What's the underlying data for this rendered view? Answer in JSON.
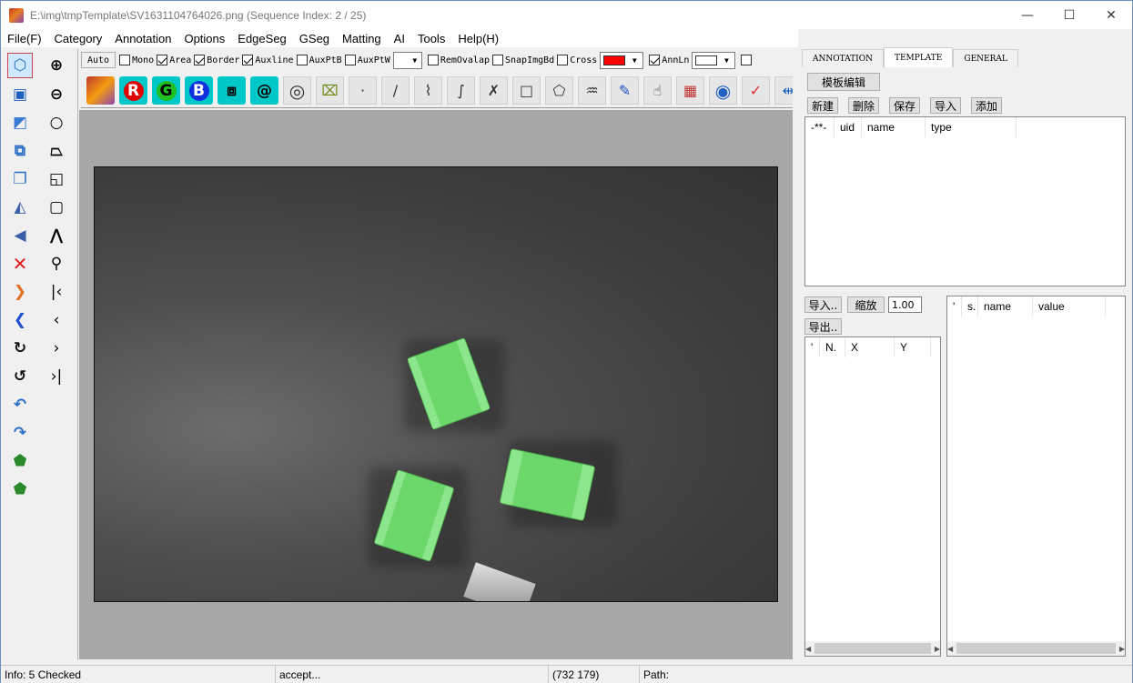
{
  "window": {
    "title": "E:\\img\\tmpTemplate\\SV1631104764026.png (Sequence Index: 2 / 25)",
    "minimize": "—",
    "maximize": "☐",
    "close": "✕"
  },
  "menu": [
    "File(F)",
    "Category",
    "Annotation",
    "Options",
    "EdgeSeg",
    "GSeg",
    "Matting",
    "AI",
    "Tools",
    "Help(H)"
  ],
  "options": {
    "auto_label": "Auto",
    "mono": {
      "label": "Mono",
      "checked": false
    },
    "area": {
      "label": "Area",
      "checked": true
    },
    "border": {
      "label": "Border",
      "checked": true
    },
    "auxline": {
      "label": "Auxline",
      "checked": true
    },
    "auxptb": {
      "label": "AuxPtB",
      "checked": false
    },
    "auxptw": {
      "label": "AuxPtW",
      "checked": false
    },
    "removalap": {
      "label": "RemOvalap",
      "checked": false
    },
    "snapimgbd": {
      "label": "SnapImgBd",
      "checked": false
    },
    "cross": {
      "label": "Cross",
      "checked": false
    },
    "cross_color": "#ff0000",
    "annln": {
      "label": "AnnLn",
      "checked": true
    },
    "annln_color": "#ffffff"
  },
  "draw_tools": {
    "r": "R",
    "g": "G",
    "b": "B",
    "at": "@",
    "point": "·",
    "line": "/",
    "check": "✓"
  },
  "right_panel": {
    "tabs": [
      "ANNOTATION",
      "TEMPLATE",
      "GENERAL"
    ],
    "template_edit": "模板编辑",
    "actions": [
      "新建",
      "删除",
      "保存",
      "导入",
      "添加"
    ],
    "template_table": {
      "columns": [
        "-**-",
        "uid",
        "name",
        "type"
      ]
    },
    "import_btn": "导入..",
    "scale_btn": "缩放",
    "scale_value": "1.00",
    "export_btn": "导出..",
    "points_table": {
      "columns": [
        "'",
        "N.",
        "X",
        "Y"
      ]
    },
    "props_table": {
      "columns": [
        "'",
        "s.",
        "name",
        "value"
      ]
    }
  },
  "status": {
    "info": "Info: 5 Checked",
    "message": "accept...",
    "coords": "(732  179)",
    "path": "Path:"
  },
  "colors": {
    "annotation_fill": "#6cd86c",
    "accent_red": "#ff0000",
    "teal_tool": "#00c8c8"
  }
}
